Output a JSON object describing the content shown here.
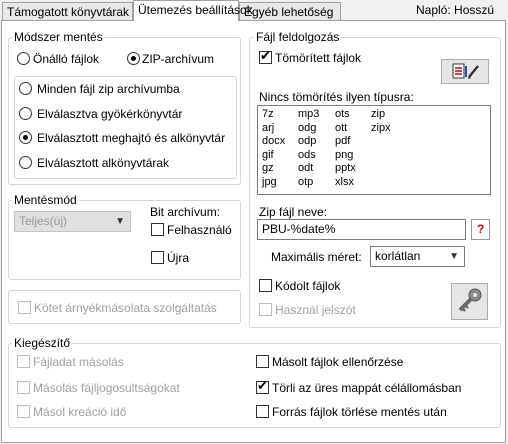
{
  "tabs": [
    "Támogatott könyvtárak",
    "Ütemezés beállítások",
    "Egyéb lehetőség"
  ],
  "log_level": "Napló: Hosszú",
  "method": {
    "title": "Módszer mentés",
    "opt_individual": "Önálló fájlok",
    "opt_zip": "ZIP-archívum",
    "opt_all_in_one": "Minden fájl zip archívumba",
    "opt_separate_root": "Elválasztva gyökérkönyvtár",
    "opt_separate_drive": "Elválasztott meghajtó és alkönyvtár",
    "opt_separate_sub": "Elválasztott alkönyvtárak",
    "selected_format": "ZIP-archívum",
    "selected_split": "Elválasztott meghajtó és alkönyvtár"
  },
  "save_mode": {
    "title": "Mentésmód",
    "select_value": "Teljes(új)",
    "bit_archive_label": "Bit archívum:",
    "user_label": "Felhasználó",
    "again_label": "Újra"
  },
  "shadow_copy": "Kötet árnyékmásolata szolgáltatás",
  "file_processing": {
    "title": "Fájl feldolgozás",
    "compressed_files": "Tömörített fájlok",
    "no_compress_label": "Nincs tömörítés ilyen típusra:",
    "extensions": {
      "col1": [
        "7z",
        "arj",
        "docx",
        "gif",
        "gz",
        "jpg"
      ],
      "col2": [
        "mp3",
        "odg",
        "odp",
        "ods",
        "odt",
        "otp"
      ],
      "col3": [
        "ots",
        "ott",
        "pdf",
        "png",
        "pptx",
        "xlsx"
      ],
      "col4": [
        "zip",
        "zipx"
      ]
    },
    "zip_name_label": "Zip fájl neve:",
    "zip_name_value": "PBU-%date%",
    "help_button": "?",
    "max_size_label": "Maximális méret:",
    "max_size_value": "korlátlan",
    "encoded_files": "Kódolt fájlok",
    "use_password": "Használ jelszót"
  },
  "extras": {
    "title": "Kiegészítő",
    "copy_file_data": "Fájladat másolás",
    "copy_permissions": "Másolás fájljogosultságokat",
    "copy_creation_time": "Másol kreáció idő",
    "verify_copied": "Másolt fájlok ellenőrzése",
    "delete_empty_folder": "Törli az üres mappát célállomásban",
    "delete_source": "Forrás fájlok törlése mentés után"
  },
  "colors": {
    "accent_edit": "#c00000",
    "help_red": "#d00000"
  }
}
